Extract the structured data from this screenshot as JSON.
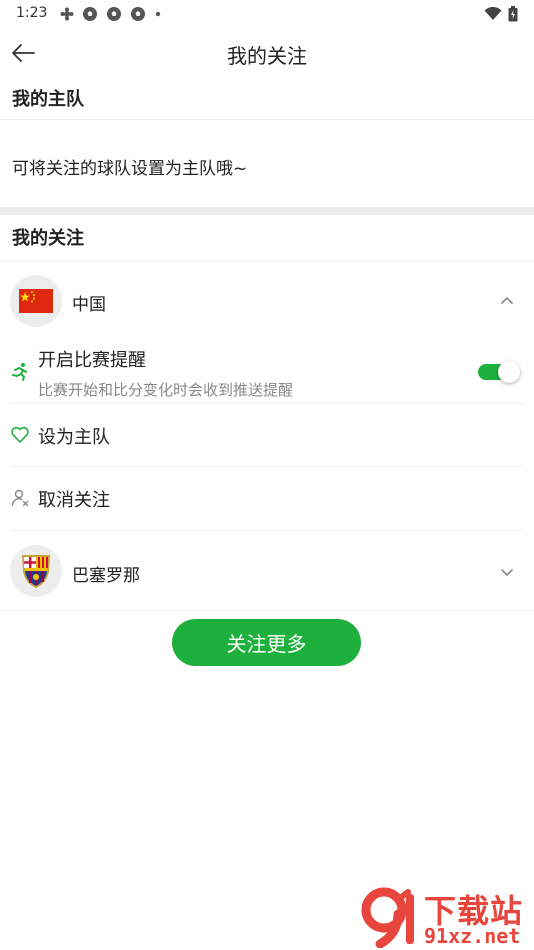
{
  "status_bar": {
    "time": "1:23",
    "left_icons": [
      "flower-icon",
      "soccer-ball-icon",
      "soccer-ball-icon",
      "soccer-ball-icon",
      "dot-icon"
    ],
    "right_icons": [
      "wifi-icon",
      "battery-icon"
    ]
  },
  "header": {
    "title": "我的关注",
    "back_icon": "arrow-left-icon"
  },
  "main_team": {
    "section_title": "我的主队",
    "hint": "可将关注的球队设置为主队哦~"
  },
  "followed": {
    "section_title": "我的关注",
    "teams": [
      {
        "name": "中国",
        "icon": "china-flag-icon",
        "expanded": true,
        "options": {
          "alert_title": "开启比赛提醒",
          "alert_desc": "比赛开始和比分变化时会收到推送提醒",
          "alert_enabled": true,
          "set_main": "设为主队",
          "unfollow": "取消关注"
        }
      },
      {
        "name": "巴塞罗那",
        "icon": "barcelona-crest-icon",
        "expanded": false
      }
    ]
  },
  "follow_more_label": "关注更多",
  "watermark": {
    "line1": "下载站",
    "line2": "91xz.net"
  },
  "colors": {
    "accent": "#1eb03d",
    "divider": "#eeeeee",
    "band": "#ececec",
    "watermark": "#e8453c"
  }
}
